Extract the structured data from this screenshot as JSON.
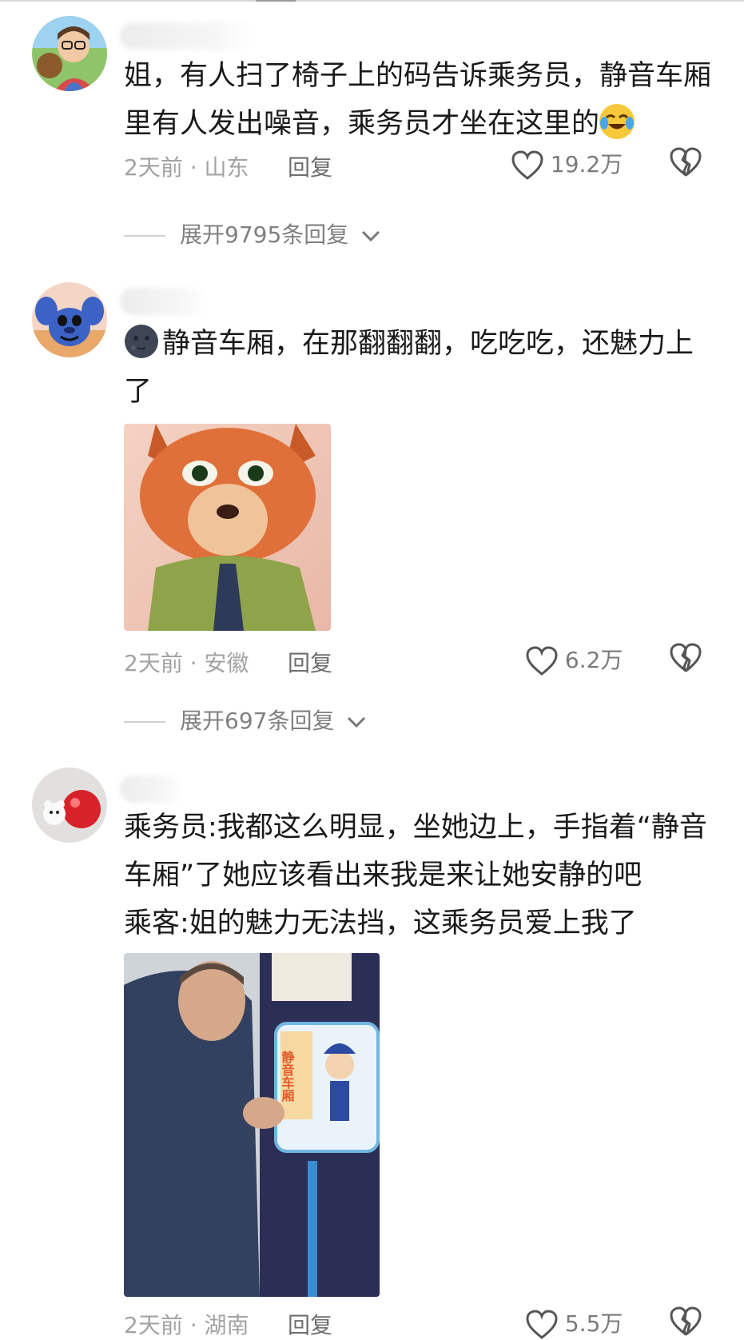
{
  "comments": [
    {
      "text": "姐，有人扫了椅子上的码告诉乘务员，静音车厢里有人发出噪音，乘务员才坐在这里的",
      "emoji": "crying-laughing-emoji",
      "time_location": "2天前 · 山东",
      "reply_label": "回复",
      "likes": "19.2万",
      "expand_label": "展开9795条回复"
    },
    {
      "text": "静音车厢，在那翻翻翻，吃吃吃，还魅力上了",
      "emoji": "dark-moon-face-emoji",
      "time_location": "2天前 · 安徽",
      "reply_label": "回复",
      "likes": "6.2万",
      "expand_label": "展开697条回复"
    },
    {
      "lines": [
        "乘务员:我都这么明显，坐她边上，手指着“静音",
        "车厢”了她应该看出来我是来让她安静的吧",
        "乘客:姐的魅力无法挡，这乘务员爱上我了"
      ],
      "image_text": "静音车厢",
      "time_location": "2天前 · 湖南",
      "reply_label": "回复",
      "likes": "5.5万"
    }
  ],
  "colors": {
    "text": "#1a1a1a",
    "meta": "#a3a3a3",
    "reply": "#6e6e6e"
  },
  "icons": [
    "heart-outline-icon",
    "broken-heart-icon",
    "chevron-down-icon"
  ]
}
